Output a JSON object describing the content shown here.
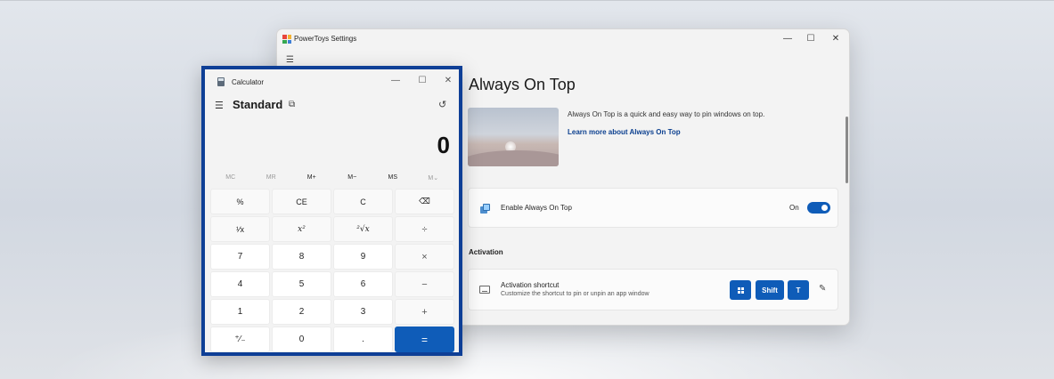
{
  "colors": {
    "accent": "#0f5cb8",
    "frame": "#0e3f96",
    "link": "#0b3f8f",
    "logo": [
      "#e8453c",
      "#f2b233",
      "#36a852",
      "#3e7fd6"
    ]
  },
  "powertoys": {
    "window_title": "PowerToys Settings",
    "controls": {
      "minimize": "—",
      "maximize": "☐",
      "close": "✕"
    },
    "menu_icon": "☰",
    "heading": "Always On Top",
    "description": "Always On Top is a quick and easy way to pin windows on top.",
    "learn_more": "Learn more about Always On Top",
    "enable": {
      "label": "Enable Always On Top",
      "state_text": "On",
      "is_on": true
    },
    "section_title": "Activation",
    "shortcut": {
      "title": "Activation shortcut",
      "subtitle": "Customize the shortcut to pin or unpin an app window",
      "keys": [
        "win-key-icon",
        "Shift",
        "T"
      ],
      "shift_label": "Shift",
      "t_label": "T",
      "edit_icon": "✎"
    }
  },
  "calculator": {
    "window_title": "Calculator",
    "controls": {
      "minimize": "—",
      "maximize": "☐",
      "close": "✕"
    },
    "menu_icon": "☰",
    "mode": "Standard",
    "keep_on_top_icon": "⧉",
    "history_icon": "↺",
    "display_value": "0",
    "memory": [
      {
        "label": "MC",
        "enabled": false
      },
      {
        "label": "MR",
        "enabled": false
      },
      {
        "label": "M+",
        "enabled": true
      },
      {
        "label": "M−",
        "enabled": true
      },
      {
        "label": "MS",
        "enabled": true
      },
      {
        "label": "M⌄",
        "enabled": false
      }
    ],
    "keys": [
      {
        "label": "%",
        "kind": "fn",
        "name": "percent-button"
      },
      {
        "label": "CE",
        "kind": "fn",
        "name": "clear-entry-button"
      },
      {
        "label": "C",
        "kind": "fn",
        "name": "clear-button"
      },
      {
        "label": "⌫",
        "kind": "fn",
        "name": "backspace-button"
      },
      {
        "label": "¹⁄x",
        "kind": "fn",
        "name": "reciprocal-button"
      },
      {
        "label": "x²",
        "kind": "ital",
        "name": "square-button"
      },
      {
        "label": "²√x",
        "kind": "ital",
        "name": "square-root-button"
      },
      {
        "label": "÷",
        "kind": "op",
        "name": "divide-button"
      },
      {
        "label": "7",
        "kind": "num",
        "name": "digit-7-button"
      },
      {
        "label": "8",
        "kind": "num",
        "name": "digit-8-button"
      },
      {
        "label": "9",
        "kind": "num",
        "name": "digit-9-button"
      },
      {
        "label": "×",
        "kind": "op",
        "name": "multiply-button"
      },
      {
        "label": "4",
        "kind": "num",
        "name": "digit-4-button"
      },
      {
        "label": "5",
        "kind": "num",
        "name": "digit-5-button"
      },
      {
        "label": "6",
        "kind": "num",
        "name": "digit-6-button"
      },
      {
        "label": "−",
        "kind": "op",
        "name": "minus-button"
      },
      {
        "label": "1",
        "kind": "num",
        "name": "digit-1-button"
      },
      {
        "label": "2",
        "kind": "num",
        "name": "digit-2-button"
      },
      {
        "label": "3",
        "kind": "num",
        "name": "digit-3-button"
      },
      {
        "label": "+",
        "kind": "op",
        "name": "plus-button"
      },
      {
        "label": "⁺⁄₋",
        "kind": "num",
        "name": "negate-button"
      },
      {
        "label": "0",
        "kind": "num",
        "name": "digit-0-button"
      },
      {
        "label": ".",
        "kind": "num",
        "name": "decimal-button"
      },
      {
        "label": "=",
        "kind": "eq",
        "name": "equals-button"
      }
    ]
  }
}
